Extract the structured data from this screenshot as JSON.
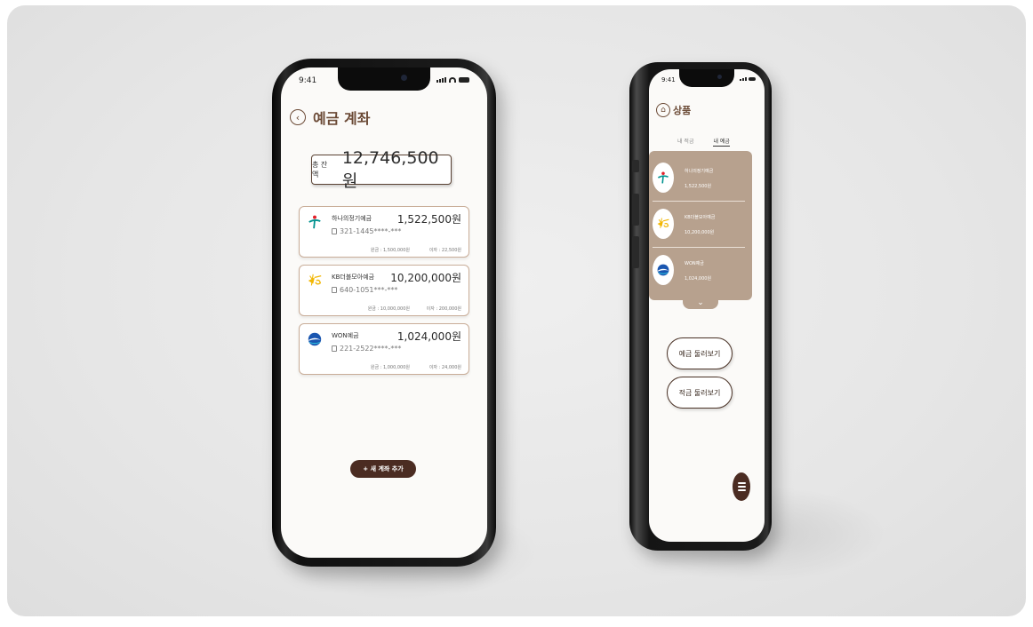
{
  "left_phone": {
    "status_time": "9:41",
    "title": "예금 계좌",
    "back_icon": "chevron-left-icon",
    "total": {
      "label": "총 잔액",
      "value": "12,746,500원"
    },
    "accounts": [
      {
        "name": "하나의정기예금",
        "balance": "1,522,500원",
        "number": "321-1445****-***",
        "principal": "원금 : 1,500,000원",
        "interest": "이자 : 22,500원",
        "logo": "hana-bank-logo"
      },
      {
        "name": "KB더블모아예금",
        "balance": "10,200,000원",
        "number": "640-1051***-***",
        "principal": "원금 : 10,000,000원",
        "interest": "이자 : 200,000원",
        "logo": "kb-bank-logo"
      },
      {
        "name": "WON예금",
        "balance": "1,024,000원",
        "number": "221-2522****-***",
        "principal": "원금 : 1,000,000원",
        "interest": "이자 : 24,000원",
        "logo": "woori-bank-logo"
      }
    ],
    "add_button": "+ 새 계좌 추가"
  },
  "right_phone": {
    "status_time": "9:41",
    "title": "상품",
    "tabs": [
      {
        "label": "내 적금",
        "active": false
      },
      {
        "label": "내 예금",
        "active": true
      }
    ],
    "products": [
      {
        "name": "하나의정기예금",
        "amount": "1,522,500원",
        "logo": "hana-bank-logo"
      },
      {
        "name": "KB더블모아예금",
        "amount": "10,200,000원",
        "logo": "kb-bank-logo"
      },
      {
        "name": "WON예금",
        "amount": "1,024,000원",
        "logo": "woori-bank-logo"
      }
    ],
    "browse_deposit": "예금 둘러보기",
    "browse_savings": "적금 둘러보기"
  },
  "colors": {
    "accent_brown": "#6b4a36",
    "dark_brown": "#4b2c22",
    "panel_tan": "#b7a18e"
  }
}
